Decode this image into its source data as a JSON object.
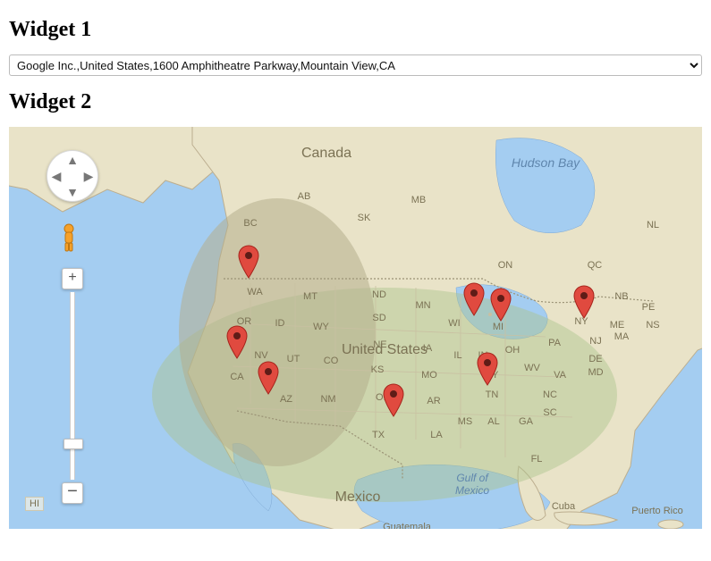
{
  "widget1": {
    "heading": "Widget 1",
    "select": {
      "selected": "Google Inc.,United States,1600 Amphitheatre Parkway,Mountain View,CA"
    }
  },
  "widget2": {
    "heading": "Widget 2"
  },
  "map": {
    "labels": {
      "country_canada": "Canada",
      "country_us": "United States",
      "country_mexico": "Mexico",
      "water_hudson": "Hudson Bay",
      "water_gulf": "Gulf of\nMexico",
      "cuba": "Cuba",
      "puertorico": "Puerto Rico",
      "guatemala": "Guatemala",
      "inset_hi": "HI"
    },
    "provinces": [
      "AB",
      "BC",
      "SK",
      "MB",
      "ON",
      "QC",
      "NL"
    ],
    "states": [
      "WA",
      "MT",
      "ND",
      "OR",
      "ID",
      "WY",
      "SD",
      "MN",
      "WI",
      "MI",
      "NY",
      "NB",
      "PE",
      "NS",
      "ME",
      "NV",
      "UT",
      "CO",
      "NE",
      "IA",
      "IL",
      "IN",
      "OH",
      "PA",
      "NJ",
      "MA",
      "CA",
      "AZ",
      "NM",
      "KS",
      "MO",
      "KY",
      "WV",
      "VA",
      "DE",
      "MD",
      "OK",
      "AR",
      "TN",
      "NC",
      "TX",
      "LA",
      "MS",
      "AL",
      "GA",
      "SC",
      "FL"
    ],
    "markers": [
      "Seattle area",
      "Northern California",
      "Southern California",
      "Wisconsin",
      "Michigan",
      "Tennessee",
      "New York",
      "Texas"
    ]
  }
}
